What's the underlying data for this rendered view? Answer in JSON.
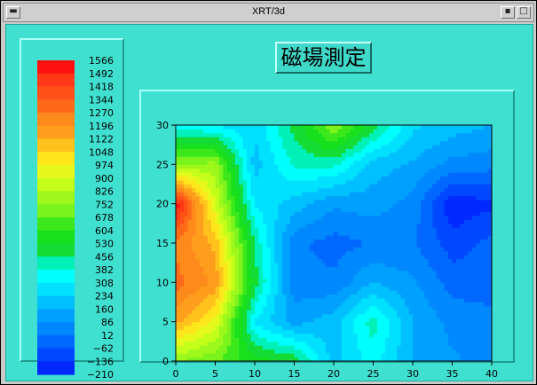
{
  "window": {
    "title": "XRT/3d"
  },
  "header": {
    "title": "磁場測定"
  },
  "colors": {
    "background": "#40e0d0",
    "panel_highlight": "#a8fff6",
    "panel_shadow": "#1f9c90"
  },
  "icons": {
    "window_menu": "minus-icon",
    "iconify": "dot-icon",
    "maximize": "square-icon"
  },
  "legend": {
    "levels": [
      "1566",
      "1492",
      "1418",
      "1344",
      "1270",
      "1196",
      "1122",
      "1048",
      "974",
      "900",
      "826",
      "752",
      "678",
      "604",
      "530",
      "456",
      "382",
      "308",
      "234",
      "160",
      "86",
      "12",
      "−62",
      "−136",
      "−210"
    ],
    "colors": [
      "#ff1010",
      "#ff3818",
      "#ff5018",
      "#ff6818",
      "#ff8a1c",
      "#ff9e1c",
      "#ffc21c",
      "#ffe61c",
      "#e6f81c",
      "#c4ff1c",
      "#9ef81c",
      "#7af41c",
      "#3ce81c",
      "#18e01c",
      "#14dc34",
      "#00f0b8",
      "#00ffff",
      "#00e0ff",
      "#00c0ff",
      "#00a0ff",
      "#0088ff",
      "#0068ff",
      "#0048ff",
      "#0028ff"
    ]
  },
  "chart_data": {
    "type": "heatmap",
    "title": "磁場測定",
    "xlabel": "",
    "ylabel": "",
    "xlim": [
      0,
      40
    ],
    "ylim": [
      0,
      30
    ],
    "x_ticks": [
      0,
      5,
      10,
      15,
      20,
      25,
      30,
      35,
      40
    ],
    "y_ticks": [
      0,
      5,
      10,
      15,
      20,
      25,
      30
    ],
    "grid": false,
    "legend_position": "left",
    "z_range": [
      -210,
      1566
    ],
    "z_levels": [
      1566,
      1492,
      1418,
      1344,
      1270,
      1196,
      1122,
      1048,
      974,
      900,
      826,
      752,
      678,
      604,
      530,
      456,
      382,
      308,
      234,
      160,
      86,
      12,
      -62,
      -136,
      -210
    ],
    "x": [
      0,
      5,
      10,
      15,
      20,
      25,
      30,
      35,
      40
    ],
    "y": [
      0,
      5,
      10,
      15,
      20,
      25,
      30
    ],
    "z": [
      [
        750,
        690,
        560,
        520,
        200,
        340,
        160,
        100,
        50
      ],
      [
        1150,
        950,
        300,
        130,
        200,
        420,
        160,
        60,
        40
      ],
      [
        1300,
        1180,
        500,
        40,
        30,
        160,
        100,
        -20,
        -30
      ],
      [
        1250,
        1100,
        450,
        30,
        -20,
        20,
        20,
        -100,
        -40
      ],
      [
        1560,
        900,
        300,
        200,
        100,
        120,
        60,
        -200,
        -150
      ],
      [
        750,
        780,
        200,
        400,
        400,
        200,
        150,
        60,
        40
      ],
      [
        350,
        300,
        250,
        480,
        760,
        500,
        250,
        200,
        160
      ]
    ]
  }
}
